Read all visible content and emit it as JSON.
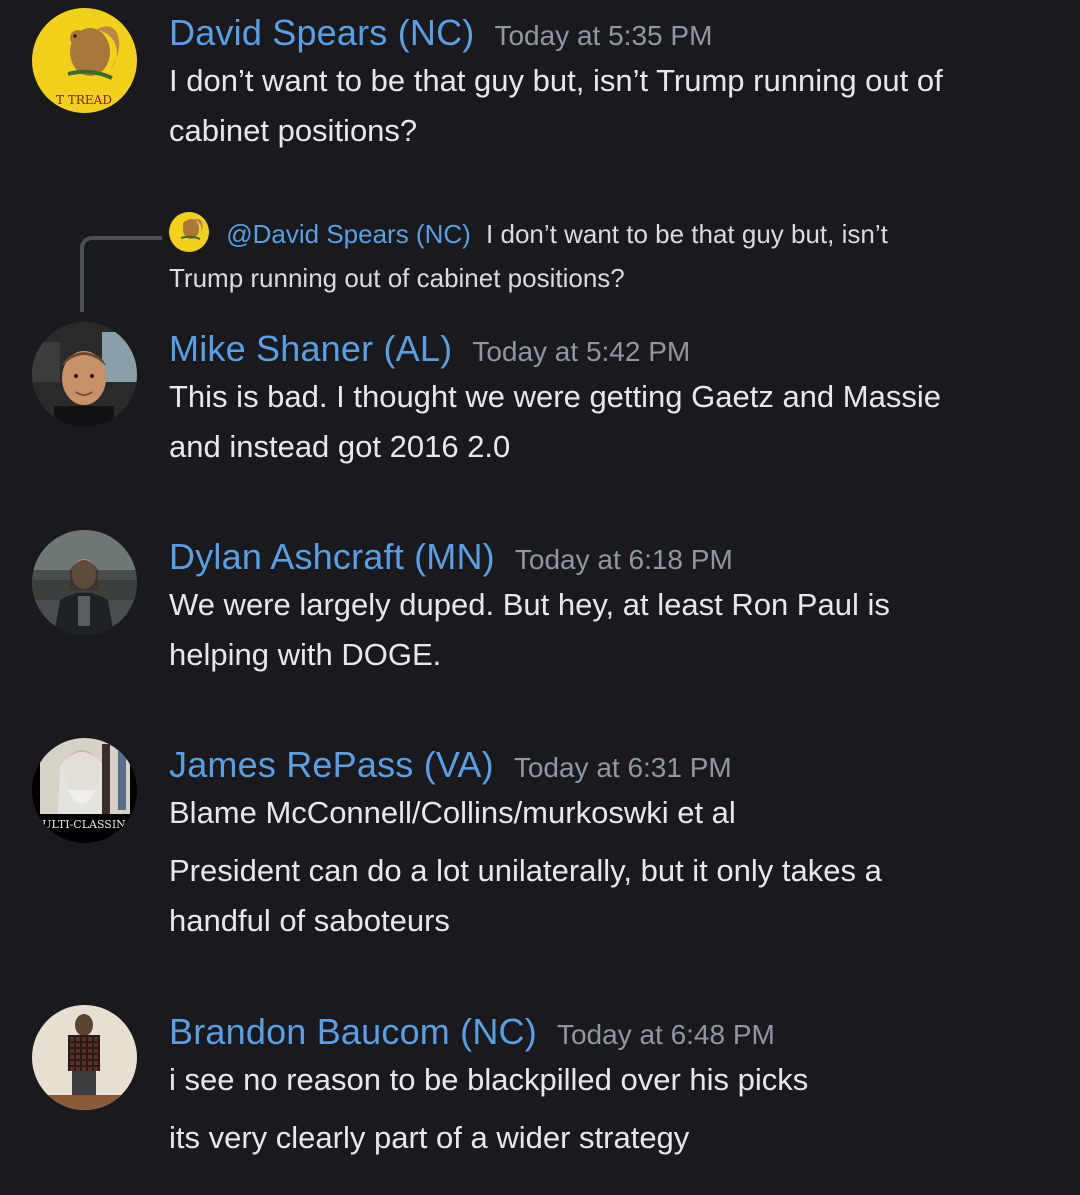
{
  "messages": [
    {
      "username": "David Spears (NC)",
      "timestamp": "Today at 5:35 PM",
      "avatar_icon": "gadsden-squirrel-avatar",
      "avatar_text": "T TREAD",
      "lines": [
        "I don’t want to be that guy but, isn’t Trump running out of",
        "cabinet positions?"
      ]
    },
    {
      "username": "Mike Shaner (AL)",
      "timestamp": "Today at 5:42 PM",
      "avatar_icon": "selfie-in-car-avatar",
      "reply": {
        "mention": "@David Spears (NC)",
        "text_first": "I don’t want to be that guy but, isn’t",
        "text_second": "Trump running out of cabinet positions?"
      },
      "lines": [
        "This is bad. I thought we were getting Gaetz and Massie",
        "and instead got 2016 2.0"
      ]
    },
    {
      "username": "Dylan Ashcraft (MN)",
      "timestamp": "Today at 6:18 PM",
      "avatar_icon": "armored-warrior-avatar",
      "lines": [
        "We were largely duped. But hey, at least Ron Paul is",
        "helping with DOGE."
      ]
    },
    {
      "username": "James RePass (VA)",
      "timestamp": "Today at 6:31 PM",
      "avatar_icon": "wizard-avatar",
      "avatar_text": "ULTI-CLASSIN",
      "lines": [
        "Blame McConnell/Collins/murkoswki et al",
        "President can do a lot unilaterally, but it only takes a",
        "handful of saboteurs"
      ]
    },
    {
      "username": "Brandon Baucom (NC)",
      "timestamp": "Today at 6:48 PM",
      "avatar_icon": "mirror-selfie-avatar",
      "lines": [
        "i see no reason to be blackpilled over his picks",
        "its very clearly part of a wider strategy"
      ]
    }
  ],
  "colors": {
    "background": "#1a1a1e",
    "username": "#5a9ee3",
    "timestamp": "#9097a0",
    "text": "#e6e8ea",
    "reply_spine": "#4d5057"
  }
}
